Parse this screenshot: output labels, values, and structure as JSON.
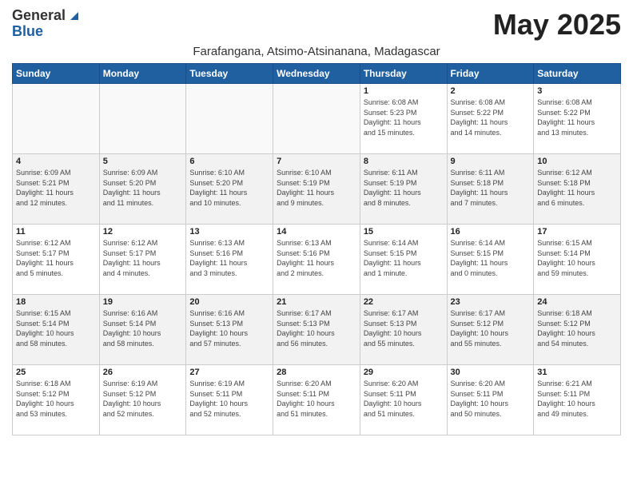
{
  "logo": {
    "general": "General",
    "blue": "Blue"
  },
  "title": "May 2025",
  "subtitle": "Farafangana, Atsimo-Atsinanana, Madagascar",
  "days_of_week": [
    "Sunday",
    "Monday",
    "Tuesday",
    "Wednesday",
    "Thursday",
    "Friday",
    "Saturday"
  ],
  "weeks": [
    [
      {
        "day": "",
        "info": ""
      },
      {
        "day": "",
        "info": ""
      },
      {
        "day": "",
        "info": ""
      },
      {
        "day": "",
        "info": ""
      },
      {
        "day": "1",
        "info": "Sunrise: 6:08 AM\nSunset: 5:23 PM\nDaylight: 11 hours\nand 15 minutes."
      },
      {
        "day": "2",
        "info": "Sunrise: 6:08 AM\nSunset: 5:22 PM\nDaylight: 11 hours\nand 14 minutes."
      },
      {
        "day": "3",
        "info": "Sunrise: 6:08 AM\nSunset: 5:22 PM\nDaylight: 11 hours\nand 13 minutes."
      }
    ],
    [
      {
        "day": "4",
        "info": "Sunrise: 6:09 AM\nSunset: 5:21 PM\nDaylight: 11 hours\nand 12 minutes."
      },
      {
        "day": "5",
        "info": "Sunrise: 6:09 AM\nSunset: 5:20 PM\nDaylight: 11 hours\nand 11 minutes."
      },
      {
        "day": "6",
        "info": "Sunrise: 6:10 AM\nSunset: 5:20 PM\nDaylight: 11 hours\nand 10 minutes."
      },
      {
        "day": "7",
        "info": "Sunrise: 6:10 AM\nSunset: 5:19 PM\nDaylight: 11 hours\nand 9 minutes."
      },
      {
        "day": "8",
        "info": "Sunrise: 6:11 AM\nSunset: 5:19 PM\nDaylight: 11 hours\nand 8 minutes."
      },
      {
        "day": "9",
        "info": "Sunrise: 6:11 AM\nSunset: 5:18 PM\nDaylight: 11 hours\nand 7 minutes."
      },
      {
        "day": "10",
        "info": "Sunrise: 6:12 AM\nSunset: 5:18 PM\nDaylight: 11 hours\nand 6 minutes."
      }
    ],
    [
      {
        "day": "11",
        "info": "Sunrise: 6:12 AM\nSunset: 5:17 PM\nDaylight: 11 hours\nand 5 minutes."
      },
      {
        "day": "12",
        "info": "Sunrise: 6:12 AM\nSunset: 5:17 PM\nDaylight: 11 hours\nand 4 minutes."
      },
      {
        "day": "13",
        "info": "Sunrise: 6:13 AM\nSunset: 5:16 PM\nDaylight: 11 hours\nand 3 minutes."
      },
      {
        "day": "14",
        "info": "Sunrise: 6:13 AM\nSunset: 5:16 PM\nDaylight: 11 hours\nand 2 minutes."
      },
      {
        "day": "15",
        "info": "Sunrise: 6:14 AM\nSunset: 5:15 PM\nDaylight: 11 hours\nand 1 minute."
      },
      {
        "day": "16",
        "info": "Sunrise: 6:14 AM\nSunset: 5:15 PM\nDaylight: 11 hours\nand 0 minutes."
      },
      {
        "day": "17",
        "info": "Sunrise: 6:15 AM\nSunset: 5:14 PM\nDaylight: 10 hours\nand 59 minutes."
      }
    ],
    [
      {
        "day": "18",
        "info": "Sunrise: 6:15 AM\nSunset: 5:14 PM\nDaylight: 10 hours\nand 58 minutes."
      },
      {
        "day": "19",
        "info": "Sunrise: 6:16 AM\nSunset: 5:14 PM\nDaylight: 10 hours\nand 58 minutes."
      },
      {
        "day": "20",
        "info": "Sunrise: 6:16 AM\nSunset: 5:13 PM\nDaylight: 10 hours\nand 57 minutes."
      },
      {
        "day": "21",
        "info": "Sunrise: 6:17 AM\nSunset: 5:13 PM\nDaylight: 10 hours\nand 56 minutes."
      },
      {
        "day": "22",
        "info": "Sunrise: 6:17 AM\nSunset: 5:13 PM\nDaylight: 10 hours\nand 55 minutes."
      },
      {
        "day": "23",
        "info": "Sunrise: 6:17 AM\nSunset: 5:12 PM\nDaylight: 10 hours\nand 55 minutes."
      },
      {
        "day": "24",
        "info": "Sunrise: 6:18 AM\nSunset: 5:12 PM\nDaylight: 10 hours\nand 54 minutes."
      }
    ],
    [
      {
        "day": "25",
        "info": "Sunrise: 6:18 AM\nSunset: 5:12 PM\nDaylight: 10 hours\nand 53 minutes."
      },
      {
        "day": "26",
        "info": "Sunrise: 6:19 AM\nSunset: 5:12 PM\nDaylight: 10 hours\nand 52 minutes."
      },
      {
        "day": "27",
        "info": "Sunrise: 6:19 AM\nSunset: 5:11 PM\nDaylight: 10 hours\nand 52 minutes."
      },
      {
        "day": "28",
        "info": "Sunrise: 6:20 AM\nSunset: 5:11 PM\nDaylight: 10 hours\nand 51 minutes."
      },
      {
        "day": "29",
        "info": "Sunrise: 6:20 AM\nSunset: 5:11 PM\nDaylight: 10 hours\nand 51 minutes."
      },
      {
        "day": "30",
        "info": "Sunrise: 6:20 AM\nSunset: 5:11 PM\nDaylight: 10 hours\nand 50 minutes."
      },
      {
        "day": "31",
        "info": "Sunrise: 6:21 AM\nSunset: 5:11 PM\nDaylight: 10 hours\nand 49 minutes."
      }
    ]
  ]
}
